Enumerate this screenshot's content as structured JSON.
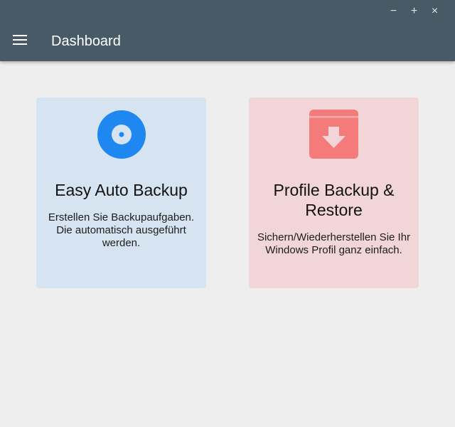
{
  "window": {
    "minimize_label": "−",
    "maximize_label": "+",
    "close_label": "×"
  },
  "header": {
    "title": "Dashboard"
  },
  "cards": [
    {
      "title": "Easy Auto Backup",
      "description": "Erstellen Sie Backupaufgaben. Die automatisch ausgeführt werden.",
      "icon": "disc-icon",
      "color": "#1e88f0"
    },
    {
      "title": "Profile Backup & Restore",
      "description": "Sichern/Wiederherstellen Sie Ihr Windows Profil ganz einfach.",
      "icon": "archive-box-icon",
      "color": "#f57b7b"
    }
  ],
  "colors": {
    "appbar": "#475a66",
    "background": "#eeeeee",
    "card_a": "#d6e4f2",
    "card_b": "#f2d6d7"
  }
}
